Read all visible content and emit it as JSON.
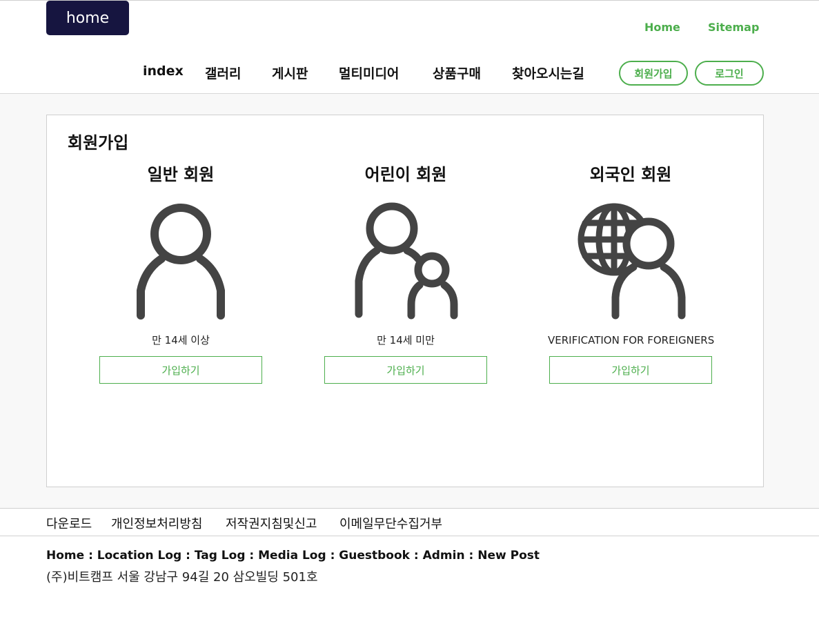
{
  "header": {
    "logo_label": "home",
    "util_links": [
      "Home",
      "Sitemap"
    ],
    "nav": [
      "index",
      "갤러리",
      "게시판",
      "멀티미디어",
      "상품구매",
      "찾아오시는길"
    ],
    "join_button": "회원가입",
    "login_button": "로그인",
    "accent_color": "#4cae4c",
    "logo_bg_color": "#161540"
  },
  "main": {
    "title": "회원가입",
    "options": [
      {
        "title": "일반 회원",
        "icon": "person-icon",
        "desc": "만 14세 이상",
        "button": "가입하기"
      },
      {
        "title": "어린이 회원",
        "icon": "parent-child-icon",
        "desc": "만 14세 미만",
        "button": "가입하기"
      },
      {
        "title": "외국인 회원",
        "icon": "globe-person-icon",
        "desc": "VERIFICATION FOR FOREIGNERS",
        "button": "가입하기"
      }
    ]
  },
  "footer": {
    "links": [
      "다운로드",
      "개인정보처리방침",
      "저작권지침및신고",
      "이메일무단수집거부"
    ],
    "nav": [
      "Home",
      "Location Log",
      "Tag Log",
      "Media Log",
      "Guestbook",
      "Admin",
      "New Post"
    ],
    "separator": " : ",
    "address": "(주)비트캠프 서울 강남구 94길 20 삼오빌딩 501호"
  }
}
